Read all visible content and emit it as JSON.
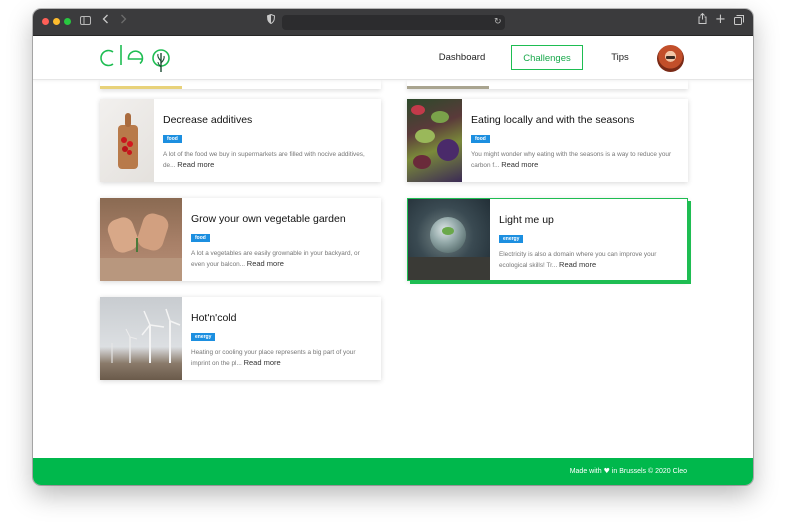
{
  "browser": {
    "traffic_lights": [
      "#ff5f57",
      "#febc2e",
      "#28c840"
    ],
    "icons": [
      "sidebar-icon",
      "back-icon",
      "forward-icon",
      "shield-icon",
      "reload-icon",
      "share-icon",
      "new-tab-icon",
      "tabs-overview-icon"
    ]
  },
  "brand": {
    "logo_text": "cleo",
    "accent_color": "#00b84c",
    "tag_color": "#1c8fe0"
  },
  "nav": {
    "items": [
      {
        "label": "Dashboard",
        "active": false
      },
      {
        "label": "Challenges",
        "active": true
      },
      {
        "label": "Tips",
        "active": false
      }
    ],
    "avatar": "user-avatar"
  },
  "challenges": [
    {
      "title": "Decrease additives",
      "tag": "food",
      "excerpt": "A lot of the food we buy in supermarkets are filled with nocive additives, de...",
      "read_more": "Read more",
      "image": "cutting-board-with-strawberries"
    },
    {
      "title": "Eating locally and with the seasons",
      "tag": "food",
      "excerpt": "You might wonder why eating with the seasons is a way to reduce your carbon f...",
      "read_more": "Read more",
      "image": "market-vegetables"
    },
    {
      "title": "Grow your own vegetable garden",
      "tag": "food",
      "excerpt": "A lot a vegetables are easily grownable in your backyard, or even your balcon...",
      "read_more": "Read more",
      "image": "hands-planting-seedling"
    },
    {
      "title": "Light me up",
      "tag": "energy",
      "excerpt": "Electricity is also a domain where you can improve your ecological skills! Tr...",
      "read_more": "Read more",
      "image": "glass-bulb-with-plant",
      "selected": true
    },
    {
      "title": "Hot'n'cold",
      "tag": "energy",
      "excerpt": "Heating or cooling your place represents a big part of your imprint on the pl...",
      "read_more": "Read more",
      "image": "wind-turbines"
    }
  ],
  "footer": {
    "text_before": "Made with",
    "heart": "♥",
    "text_after": "in Brussels © 2020 Cleo"
  }
}
